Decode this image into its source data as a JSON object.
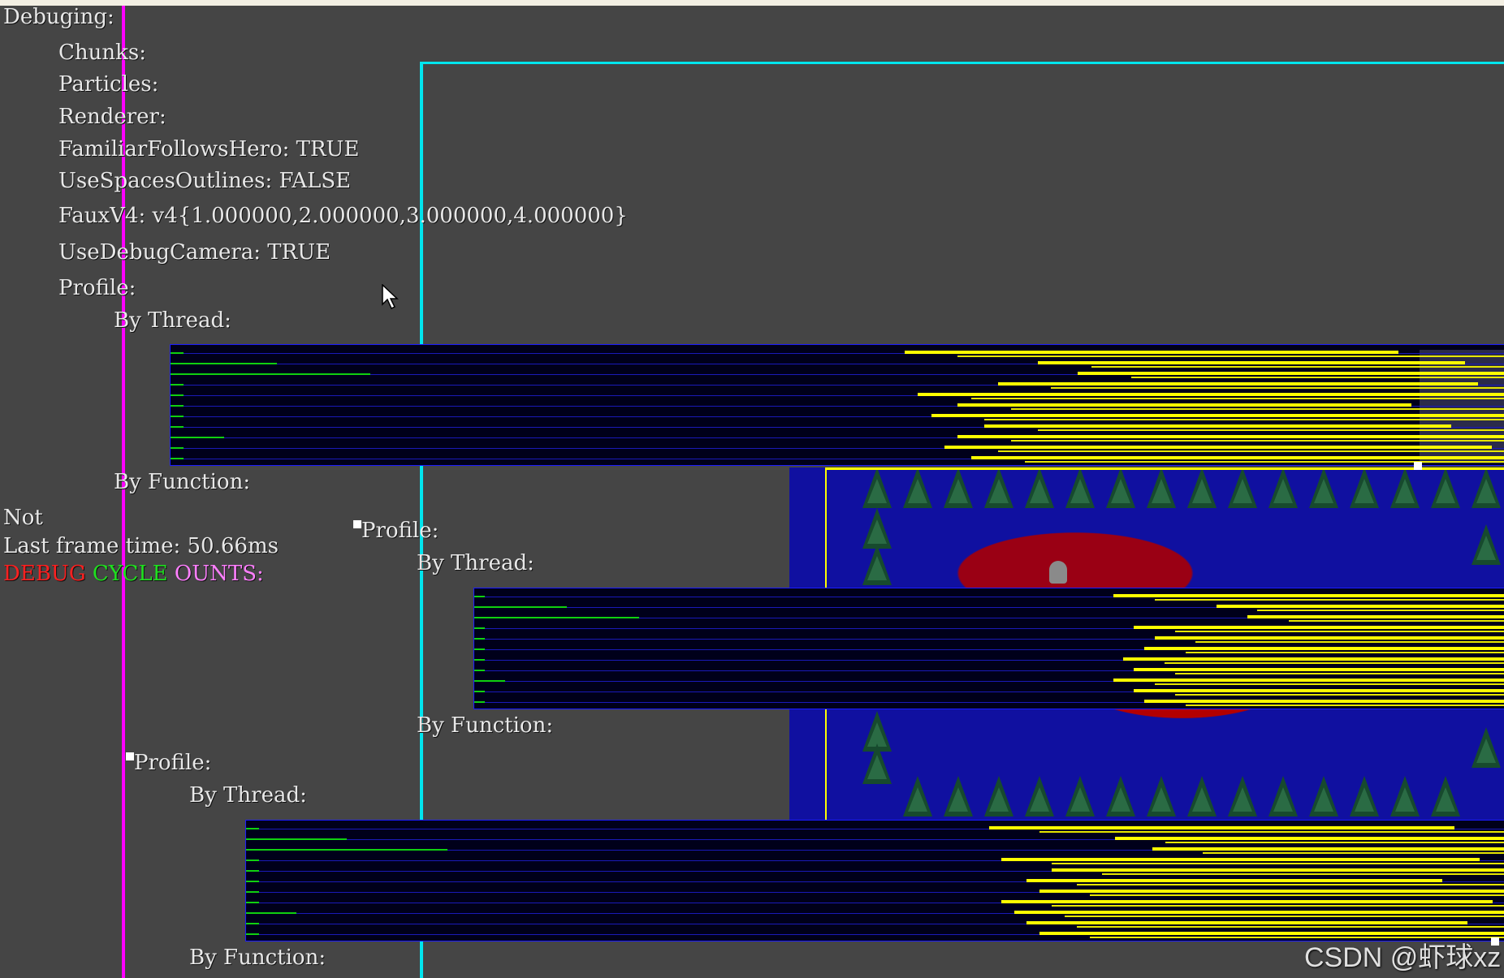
{
  "debug_menu": {
    "root": "Debuging:",
    "chunks": "Chunks:",
    "particles": "Particles:",
    "renderer": "Renderer:",
    "familiar_follows_hero": "FamiliarFollowsHero: TRUE",
    "use_spaces_outlines": "UseSpacesOutlines: FALSE",
    "faux_v4": "FauxV4: v4{1.000000,2.000000,3.000000,4.000000}",
    "use_debug_camera": "UseDebugCamera: TRUE",
    "profile": "Profile:",
    "by_thread": "By Thread:",
    "by_function": "By Function:"
  },
  "status": {
    "not_label": "Not",
    "last_frame_time": "Last frame time: 50.66ms",
    "debug_word": "DEBUG",
    "cycle_word": "CYCLE",
    "counts_word": "OUNTS:"
  },
  "profile_copy_1": {
    "profile": "Profile:",
    "by_thread": "By Thread:",
    "by_function": "By Function:"
  },
  "profile_copy_2": {
    "profile": "Profile:",
    "by_thread": "By Thread:",
    "by_function": "By Function:"
  },
  "watermark": "CSDN @虾球xz",
  "colors": {
    "background": "#454545",
    "magenta_line": "#ff00ff",
    "cyan_line": "#00e5ee",
    "yellow_bar": "#ffff00",
    "green_bar": "#10d010",
    "debug_red": "#ff2020",
    "cycle_green": "#20e020",
    "counts_pink": "#ff80ff"
  }
}
